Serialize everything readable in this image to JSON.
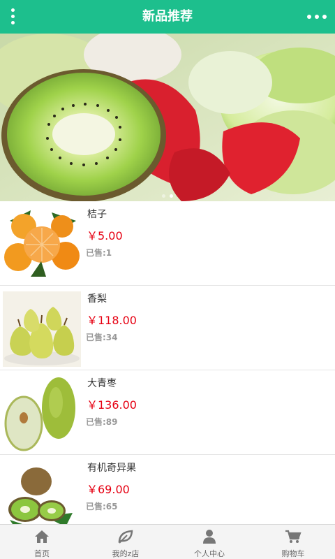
{
  "header": {
    "title": "新品推荐",
    "background": "#1dbf8d",
    "left_icon": "vertical-dots-menu",
    "right_icon": "horizontal-more-dots"
  },
  "banner": {
    "subject": "kiwi-strawberry-apple-slices",
    "slide_count": 2,
    "active_slide": 2
  },
  "products": [
    {
      "name": "桔子",
      "price": "￥5.00",
      "sold": "已售:1",
      "image": "oranges-icon"
    },
    {
      "name": "香梨",
      "price": "￥118.00",
      "sold": "已售:34",
      "image": "pears-icon"
    },
    {
      "name": "大青枣",
      "price": "￥136.00",
      "sold": "已售:89",
      "image": "green-jujube-icon"
    },
    {
      "name": "有机奇异果",
      "price": "￥69.00",
      "sold": "已售:65",
      "image": "kiwi-icon"
    }
  ],
  "tabbar": {
    "tabs": [
      {
        "label": "首页",
        "icon": "home-icon"
      },
      {
        "label": "我的z店",
        "icon": "leaf-icon"
      },
      {
        "label": "个人中心",
        "icon": "user-icon"
      },
      {
        "label": "购物车",
        "icon": "cart-icon"
      }
    ]
  },
  "colors": {
    "accent": "#1dbf8d",
    "price": "#e60012",
    "muted": "#999999"
  }
}
